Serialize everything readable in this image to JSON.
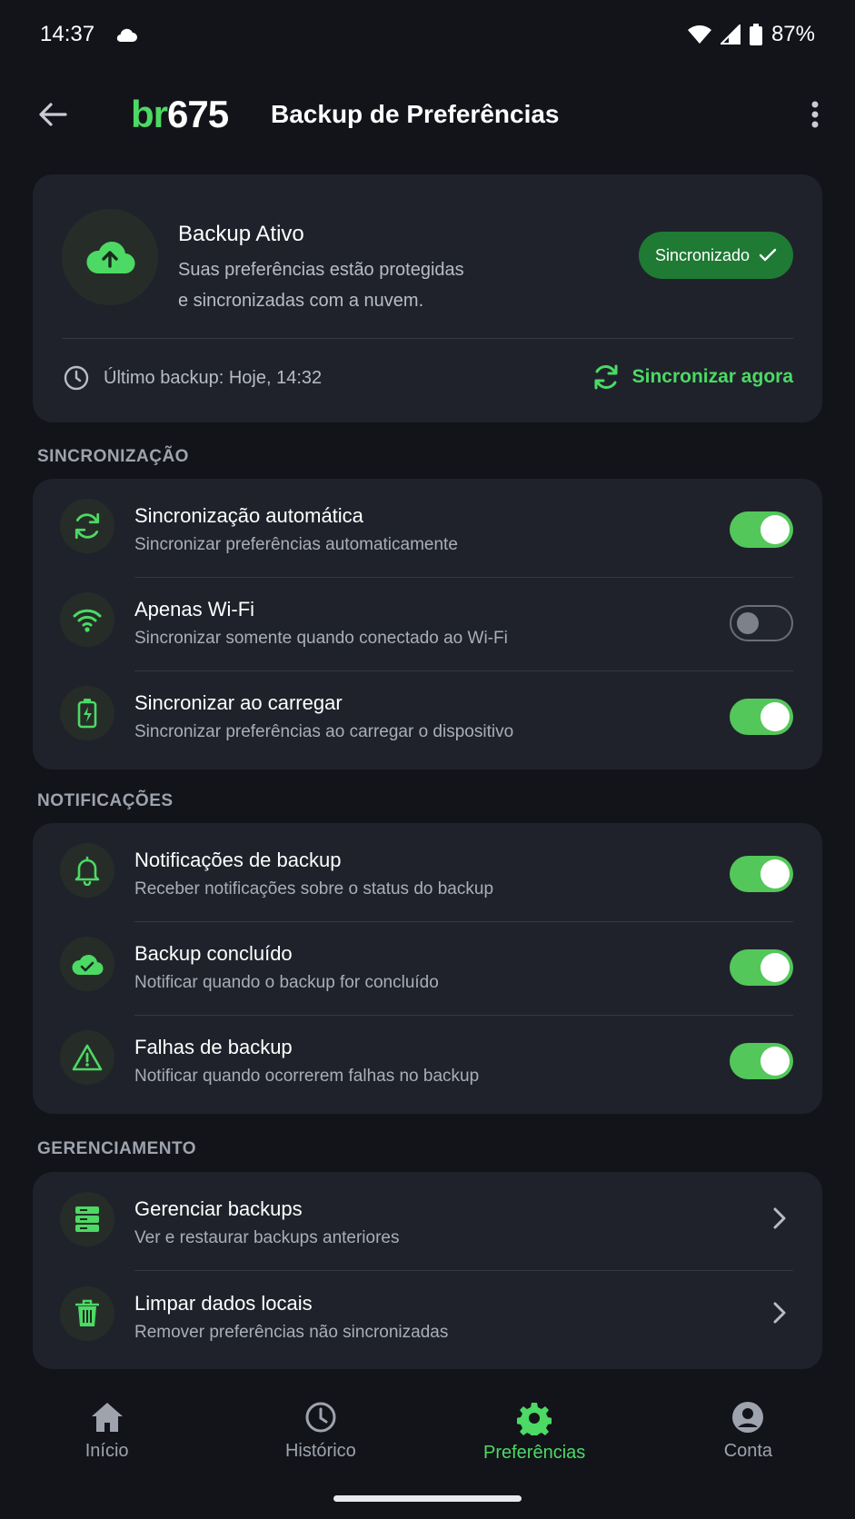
{
  "status_bar": {
    "time": "14:37",
    "battery": "87%",
    "icons": [
      "cloud-icon",
      "wifi-icon",
      "signal-icon",
      "battery-icon"
    ]
  },
  "app_bar": {
    "logo_br": "br",
    "logo_num": "675",
    "title": "Backup de Preferências"
  },
  "backup_card": {
    "title": "Backup Ativo",
    "desc_line1": "Suas preferências estão protegidas",
    "desc_line2": "e sincronizadas com a nuvem.",
    "badge": "Sincronizado",
    "last_backup": "Último backup: Hoje, 14:32",
    "sync_now": "Sincronizar agora"
  },
  "sections": {
    "sync": {
      "label": "SINCRONIZAÇÃO",
      "items": [
        {
          "title": "Sincronização automática",
          "subtitle": "Sincronizar preferências automaticamente",
          "enabled": true,
          "icon": "sync-icon"
        },
        {
          "title": "Apenas Wi-Fi",
          "subtitle": "Sincronizar somente quando conectado ao Wi-Fi",
          "enabled": false,
          "icon": "wifi-icon"
        },
        {
          "title": "Sincronizar ao carregar",
          "subtitle": "Sincronizar preferências ao carregar o dispositivo",
          "enabled": true,
          "icon": "battery-charging-icon"
        }
      ]
    },
    "notifications": {
      "label": "NOTIFICAÇÕES",
      "items": [
        {
          "title": "Notificações de backup",
          "subtitle": "Receber notificações sobre o status do backup",
          "enabled": true,
          "icon": "bell-icon"
        },
        {
          "title": "Backup concluído",
          "subtitle": "Notificar quando o backup for concluído",
          "enabled": true,
          "icon": "cloud-check-icon"
        },
        {
          "title": "Falhas de backup",
          "subtitle": "Notificar quando ocorrerem falhas no backup",
          "enabled": true,
          "icon": "warning-icon"
        }
      ]
    },
    "management": {
      "label": "GERENCIAMENTO",
      "items": [
        {
          "title": "Gerenciar backups",
          "subtitle": "Ver e restaurar backups anteriores",
          "icon": "server-icon"
        },
        {
          "title": "Limpar dados locais",
          "subtitle": "Remover preferências não sincronizadas",
          "icon": "trash-icon"
        }
      ]
    }
  },
  "bottom_nav": {
    "items": [
      {
        "label": "Início",
        "icon": "home-icon",
        "active": false
      },
      {
        "label": "Histórico",
        "icon": "clock-icon",
        "active": false
      },
      {
        "label": "Preferências",
        "icon": "gear-icon",
        "active": true
      },
      {
        "label": "Conta",
        "icon": "account-icon",
        "active": false
      }
    ]
  },
  "colors": {
    "accent": "#4cd964",
    "background": "#12141a",
    "card": "#1f222b",
    "badge": "#1f7a34"
  }
}
